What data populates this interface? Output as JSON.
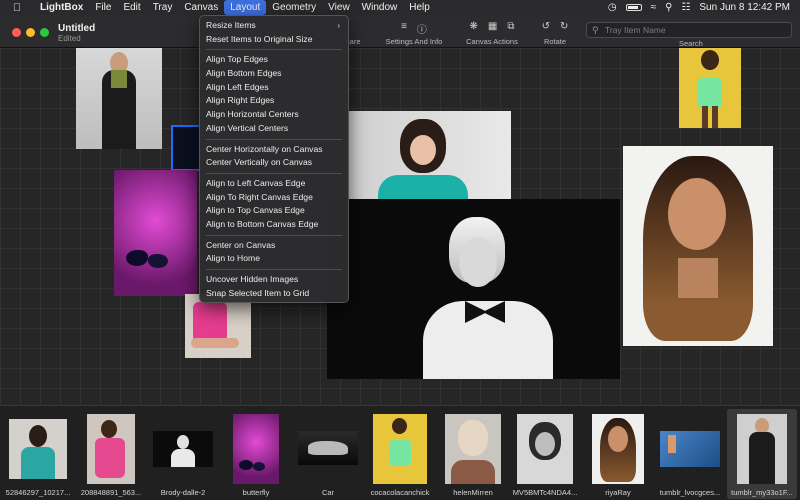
{
  "menubar": {
    "app_name": "LightBox",
    "items": [
      "File",
      "Edit",
      "Tray",
      "Canvas",
      "Layout",
      "Geometry",
      "View",
      "Window",
      "Help"
    ],
    "active_item": "Layout",
    "clock": "Sun Jun 8   12:42 PM"
  },
  "window": {
    "title": "Untitled",
    "subtitle": "Edited"
  },
  "toolbar": {
    "share_label": "hare",
    "settings_label": "Settings And Info",
    "canvas_actions_label": "Canvas Actions",
    "rotate_label": "Rotate",
    "search_placeholder": "Tray Item Name",
    "search_label": "Search"
  },
  "layout_menu": {
    "groups": [
      [
        "Resize Items",
        "Reset Items to Original Size"
      ],
      [
        "Align Top Edges",
        "Align Bottom Edges",
        "Align Left Edges",
        "Align Right Edges",
        "Align Horizontal Centers",
        "Align Vertical Centers"
      ],
      [
        "Center Horizontally on Canvas",
        "Center Vertically on Canvas"
      ],
      [
        "Align to Left Canvas Edge",
        "Align To Right Canvas Edge",
        "Align to Top Canvas Edge",
        "Align to Bottom Canvas Edge"
      ],
      [
        "Center on Canvas",
        "Align to Home"
      ],
      [
        "Uncover Hidden Images",
        "Snap Selected Item to Grid"
      ]
    ]
  },
  "tray": {
    "items": [
      {
        "name": "52846297_10217..."
      },
      {
        "name": "208848891_563..."
      },
      {
        "name": "Brody-dalle-2"
      },
      {
        "name": "butterfly"
      },
      {
        "name": "Car"
      },
      {
        "name": "cocacolacanchick"
      },
      {
        "name": "helenMirren"
      },
      {
        "name": "MV5BMTc4NDA4..."
      },
      {
        "name": "riyaRay"
      },
      {
        "name": "tumblr_lvocgces..."
      },
      {
        "name": "tumblr_my33o1F..."
      }
    ],
    "selected_index": 10
  }
}
